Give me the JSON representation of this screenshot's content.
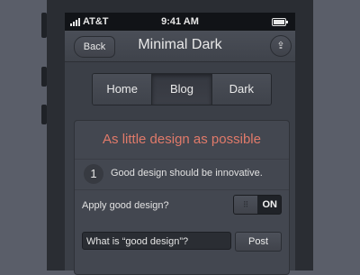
{
  "status": {
    "carrier": "AT&T",
    "time": "9:41 AM"
  },
  "nav": {
    "back": "Back",
    "title": "Minimal Dark"
  },
  "segments": [
    "Home",
    "Blog",
    "Dark"
  ],
  "active_segment": 1,
  "card": {
    "title": "As little design as possible",
    "item_number": "1",
    "item_text": "Good design should be innovative.",
    "toggle_label": "Apply good design?",
    "toggle_state": "ON",
    "input_value": "What is “good design”?",
    "post_label": "Post"
  },
  "colors": {
    "accent": "#e07a6a",
    "background": "#5a5e69",
    "screen": "#3b3f47"
  }
}
